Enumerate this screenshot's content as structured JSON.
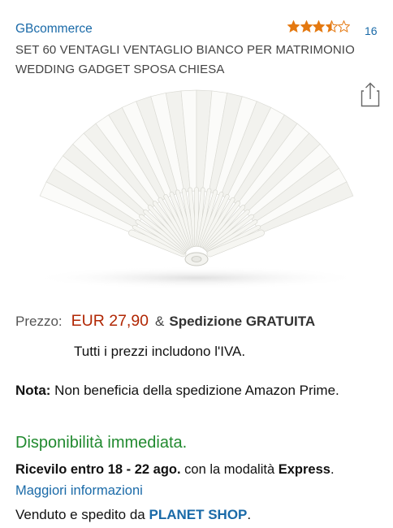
{
  "brand": "GBcommerce",
  "rating": {
    "stars": 3.5,
    "max": 5,
    "count": "16",
    "star_color": "#e47911"
  },
  "title": "SET 60 VENTAGLI VENTAGLIO BIANCO PER MATRIMONIO WEDDING GADGET SPOSA CHIESA",
  "share_icon": "share-icon",
  "price": {
    "label": "Prezzo:",
    "value": "EUR 27,90",
    "amp": "&",
    "shipping": "Spedizione GRATUITA",
    "vat_note": "Tutti i prezzi includono l'IVA.",
    "price_color": "#b12704"
  },
  "note": {
    "label": "Nota:",
    "text": " Non beneficia della spedizione Amazon Prime."
  },
  "availability": {
    "text": "Disponibilità immediata.",
    "color": "#218a2f"
  },
  "delivery": {
    "date": "Ricevilo entro 18 - 22 ago.",
    "mode_text": " con la modalità ",
    "mode": "Express",
    "sep": ". ",
    "more_link": "Maggiori informazioni"
  },
  "seller": {
    "prefix": "Venduto e spedito da ",
    "name": "PLANET SHOP",
    "suffix": "."
  },
  "colors": {
    "link": "#1a6aa8"
  }
}
